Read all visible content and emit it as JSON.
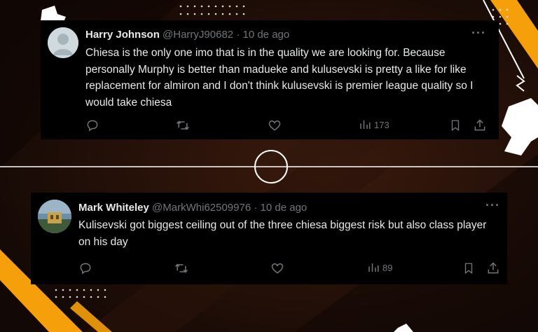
{
  "colors": {
    "background": "#1a0d08",
    "accent": "#f5a00a",
    "card": "#000000",
    "text": "#e7e9ea",
    "muted": "#71767b"
  },
  "tweets": [
    {
      "avatar": "default-avatar-icon",
      "name": "Harry Johnson",
      "handle": "@HarryJ90682",
      "sep": "·",
      "time": "10 de ago",
      "text": "Chiesa is the only one imo that is in the quality we are looking for. Because personally Murphy is better than madueke and kulusevski is pretty a like for like replacement for almiron and I don't think kulusevski is premier league quality so I would take chiesa",
      "views": "173",
      "more": "···"
    },
    {
      "avatar": "profile-photo",
      "name": "Mark Whiteley",
      "handle": "@MarkWhi62509976",
      "sep": "·",
      "time": "10 de ago",
      "text": "Kulisevski got biggest ceiling out of the three chiesa biggest risk but also class player on his day",
      "views": "89",
      "more": "···"
    }
  ]
}
